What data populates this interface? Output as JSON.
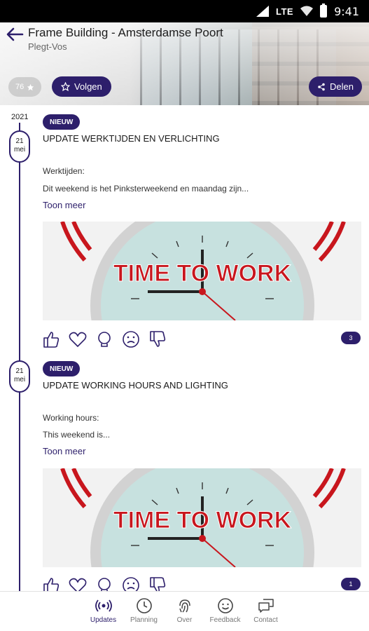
{
  "status_bar": {
    "network": "LTE",
    "time": "9:41"
  },
  "header": {
    "title": "Frame Building - Amsterdamse Poort",
    "subtitle": "Plegt-Vos",
    "rating": "76",
    "follow_label": "Volgen",
    "share_label": "Delen"
  },
  "timeline": {
    "year": "2021"
  },
  "posts": [
    {
      "day": "21",
      "month": "mei",
      "badge": "NIEUW",
      "title": "UPDATE WERKTIJDEN EN VERLICHTING",
      "body_line1": "Werktijden:",
      "body_line2": "Dit weekend is het Pinksterweekend en maandag zijn...",
      "show_more": "Toon meer",
      "image_text": "TIME TO WORK",
      "reaction_count": "3"
    },
    {
      "day": "21",
      "month": "mei",
      "badge": "NIEUW",
      "title": "UPDATE WORKING HOURS AND LIGHTING",
      "body_line1": "Working hours:",
      "body_line2": "This weekend is...",
      "show_more": "Toon meer",
      "image_text": "TIME TO WORK",
      "reaction_count": "1"
    }
  ],
  "nav": {
    "items": [
      {
        "label": "Updates",
        "icon": "broadcast-icon",
        "active": true
      },
      {
        "label": "Planning",
        "icon": "clock-icon"
      },
      {
        "label": "Over",
        "icon": "fingerprint-icon"
      },
      {
        "label": "Feedback",
        "icon": "smiley-icon"
      },
      {
        "label": "Contact",
        "icon": "chat-icon"
      }
    ]
  },
  "colors": {
    "accent": "#2d1f6b",
    "clock_red": "#c8161d"
  }
}
